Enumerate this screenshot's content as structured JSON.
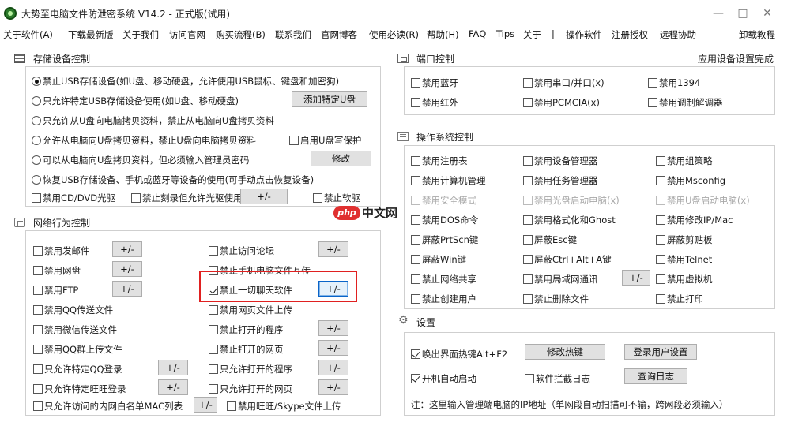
{
  "window": {
    "title": "大势至电脑文件防泄密系统 V14.2 - 正式版(试用)",
    "minimize": "—",
    "maximize": "□",
    "close": "✕"
  },
  "menu": [
    "关于软件(A)",
    "下载最新版",
    "关于我们",
    "访问官网",
    "购买流程(B)",
    "联系我们",
    "官网博客",
    "使用必读(R)",
    "帮助(H)",
    "FAQ",
    "Tips",
    "关于",
    "|",
    "操作软件",
    "注册授权",
    "远程协助",
    "卸载教程"
  ],
  "storage": {
    "title": "存储设备控制",
    "radios": [
      {
        "label": "禁止USB存储设备(如U盘、移动硬盘，允许使用USB鼠标、键盘和加密狗)",
        "checked": true
      },
      {
        "label": "只允许特定USB存储设备使用(如U盘、移动硬盘)",
        "checked": false
      },
      {
        "label": "只允许从U盘向电脑拷贝资料，禁止从电脑向U盘拷贝资料",
        "checked": false
      },
      {
        "label": "允许从电脑向U盘拷贝资料，禁止U盘向电脑拷贝资料",
        "checked": false
      },
      {
        "label": "可以从电脑向U盘拷贝资料，但必须输入管理员密码",
        "checked": false
      },
      {
        "label": "恢复USB存储设备、手机或蓝牙等设备的使用(可手动点击恢复设备)",
        "checked": false
      }
    ],
    "add_usb_button": "添加特定U盘",
    "write_protect": "启用U盘写保护",
    "modify_button": "修改",
    "cd_dvd": "禁用CD/DVD光驱",
    "burn": "禁止刻录但允许光驱使用",
    "burn_btn": "+/-",
    "floppy": "禁止软驱"
  },
  "network": {
    "title": "网络行为控制",
    "left": [
      {
        "label": "禁用发邮件",
        "btn": "+/-"
      },
      {
        "label": "禁用网盘",
        "btn": "+/-"
      },
      {
        "label": "禁用FTP",
        "btn": "+/-"
      },
      {
        "label": "禁用QQ传送文件",
        "btn": ""
      },
      {
        "label": "禁用微信传送文件",
        "btn": ""
      },
      {
        "label": "禁用QQ群上传文件",
        "btn": ""
      },
      {
        "label": "只允许特定QQ登录",
        "btn": "+/-"
      },
      {
        "label": "只允许特定旺旺登录",
        "btn": "+/-"
      },
      {
        "label": "只允许访问的内网白名单MAC列表",
        "btn": "+/-"
      }
    ],
    "right": [
      {
        "label": "禁止访问论坛",
        "btn": "+/-",
        "checked": false
      },
      {
        "label": "禁止手机电脑文件互传",
        "btn": "",
        "checked": false
      },
      {
        "label": "禁止一切聊天软件",
        "btn": "+/-",
        "checked": true
      },
      {
        "label": "禁用网页文件上传",
        "btn": "",
        "checked": false
      },
      {
        "label": "禁止打开的程序",
        "btn": "+/-",
        "checked": false
      },
      {
        "label": "禁止打开的网页",
        "btn": "+/-",
        "checked": false
      },
      {
        "label": "只允许打开的程序",
        "btn": "+/-",
        "checked": false
      },
      {
        "label": "只允许打开的网页",
        "btn": "+/-",
        "checked": false
      },
      {
        "label": "禁用旺旺/Skype文件上传",
        "btn": "",
        "checked": false
      }
    ]
  },
  "port": {
    "title": "端口控制",
    "apply_status": "应用设备设置完成",
    "items": [
      "禁用蓝牙",
      "禁用串口/并口(x)",
      "禁用1394",
      "禁用红外",
      "禁用PCMCIA(x)",
      "禁用调制解调器"
    ]
  },
  "os": {
    "title": "操作系统控制",
    "items": [
      {
        "label": "禁用注册表",
        "disabled": false
      },
      {
        "label": "禁用设备管理器",
        "disabled": false
      },
      {
        "label": "禁用组策略",
        "disabled": false
      },
      {
        "label": "禁用计算机管理",
        "disabled": false
      },
      {
        "label": "禁用任务管理器",
        "disabled": false
      },
      {
        "label": "禁用Msconfig",
        "disabled": false
      },
      {
        "label": "禁用安全模式",
        "disabled": true
      },
      {
        "label": "禁用光盘启动电脑(x)",
        "disabled": true
      },
      {
        "label": "禁用U盘启动电脑(x)",
        "disabled": true
      },
      {
        "label": "禁用DOS命令",
        "disabled": false
      },
      {
        "label": "禁用格式化和Ghost",
        "disabled": false
      },
      {
        "label": "禁用修改IP/Mac",
        "disabled": false
      },
      {
        "label": "屏蔽PrtScn键",
        "disabled": false
      },
      {
        "label": "屏蔽Esc键",
        "disabled": false
      },
      {
        "label": "屏蔽剪贴板",
        "disabled": false
      },
      {
        "label": "屏蔽Win键",
        "disabled": false
      },
      {
        "label": "屏蔽Ctrl+Alt+A键",
        "disabled": false
      },
      {
        "label": "禁用Telnet",
        "disabled": false
      },
      {
        "label": "禁止网络共享",
        "disabled": false
      },
      {
        "label": "禁用局域网通讯",
        "disabled": false
      },
      {
        "label": "禁用虚拟机",
        "disabled": false
      },
      {
        "label": "禁止创建用户",
        "disabled": false
      },
      {
        "label": "禁止删除文件",
        "disabled": false
      },
      {
        "label": "禁止打印",
        "disabled": false
      }
    ],
    "lan_btn": "+/-"
  },
  "settings": {
    "title": "设置",
    "hotkey": "唤出界面热键Alt+F2",
    "modify_hotkey": "修改热键",
    "login_settings": "登录用户设置",
    "autostart": "开机自动启动",
    "intercept_log": "软件拦截日志",
    "view_log": "查询日志",
    "note": "注：这里输入管理端电脑的IP地址（单网段自动扫描可不输，跨网段必须输入）"
  },
  "watermark": {
    "badge": "php",
    "text": "中文网"
  }
}
